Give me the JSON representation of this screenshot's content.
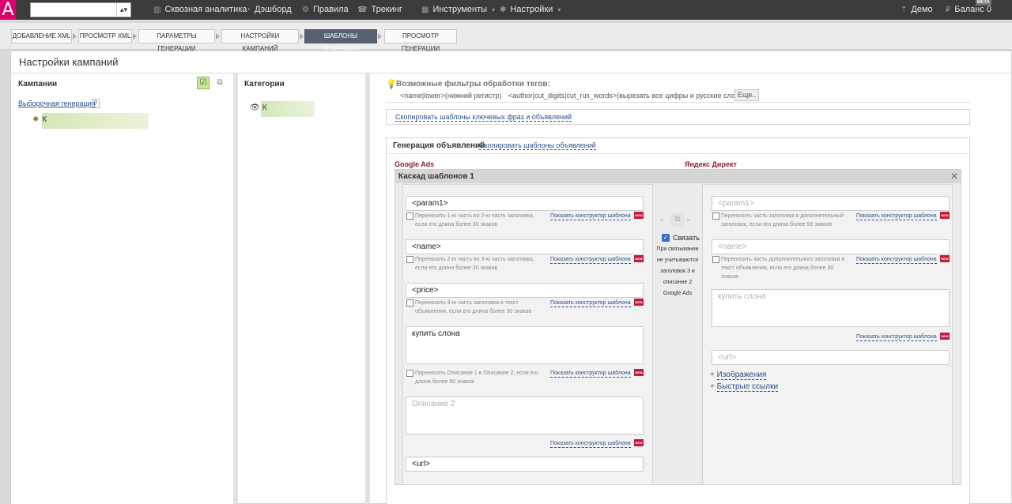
{
  "topbar": {
    "logo": "A",
    "nav": [
      {
        "label": "Сквозная аналитика",
        "icon": "bar-chart-icon"
      },
      {
        "label": "Дэшборд",
        "icon": "dashboard-icon"
      },
      {
        "label": "Правила",
        "icon": "rules-icon"
      },
      {
        "label": "Трекинг",
        "icon": "phone-icon"
      },
      {
        "label": "Инструменты",
        "icon": "grid-icon"
      },
      {
        "label": "Настройки",
        "icon": "gear-icon"
      }
    ],
    "demo": "Демо",
    "balance": "Баланс 0",
    "beta": "BETA"
  },
  "steps": [
    "ДОБАВЛЕНИЕ XML",
    "ПРОСМОТР XML",
    "ПАРАМЕТРЫ ГЕНЕРАЦИИ",
    "НАСТРОЙКИ КАМПАНИЙ",
    "ШАБЛОНЫ ГЕНЕРАЦИИ",
    "ПРОСМОТР ГЕНЕРАЦИИ"
  ],
  "page_title": "Настройки кампаний",
  "campaigns": {
    "title": "Кампании",
    "selective_link": "Выборочная генерация",
    "help": "?",
    "item": "К"
  },
  "categories": {
    "title": "Категории",
    "item": "К"
  },
  "filters": {
    "title": "Возможные фильтры обработки тегов:",
    "f1_code": "<name|lower>",
    "f1_desc": "(нижний регистр)",
    "f2_code": "<author|cut_digits|cut_rus_words>",
    "f2_desc": "(вырезать все цифры и русские слова)",
    "more": "Еще.."
  },
  "copy_all_link": "Скопировать шаблоны ключевых фраз и объявлений",
  "ad_gen": {
    "title": "Генерация объявлений",
    "copy_link": "Скопировать шаблоны объявлений",
    "google_title": "Google Ads",
    "yandex_title": "Яндекс Директ",
    "cascade_title": "Каскад шаблонов 1",
    "close": "✕",
    "constructor": "Показать конструктор шаблона",
    "new": "NEW",
    "google": {
      "f1": "<param1>",
      "n1a": "Переносить 1-ю часть во 2-ю часть заголовка,",
      "n1b": "если его длина более 30 знаков",
      "f2": "<name>",
      "n2a": "Переносить 2-ю часть во 3-ю часть заголовка,",
      "n2b": "если его длина более 30 знаков",
      "f3": "<price>",
      "n3a": "Переносить 3-ю часть заголовка в текст",
      "n3b": "объявления, если его длина более 30 знаков",
      "f4": "купить слона",
      "n4a": "Переносить Описание 1 в Описание 2, если его",
      "n4b": "длина более 90 знаков",
      "f5_ph": "Описание 2",
      "f6": "<url>"
    },
    "link": {
      "label": "Связать",
      "checked": true,
      "note": [
        "При связывании",
        "не учитываются",
        "заголовок 3 и",
        "описание 2",
        "Google Ads"
      ]
    },
    "yandex": {
      "f1_ph": "<param1>",
      "n1a": "Переносить часть заголовка в дополнительный",
      "n1b": "заголовок, если его длина более 56 знаков",
      "f2_ph": "<name>",
      "n2a": "Переносить часть дополнительного заголовка в",
      "n2b": "текст объявления, если его длина более 30",
      "n2c": "знаков",
      "f3_ph": "купить слона",
      "f4_ph": "<url>",
      "images": "Изображения",
      "quick_links": "Быстрые ссылки"
    }
  }
}
